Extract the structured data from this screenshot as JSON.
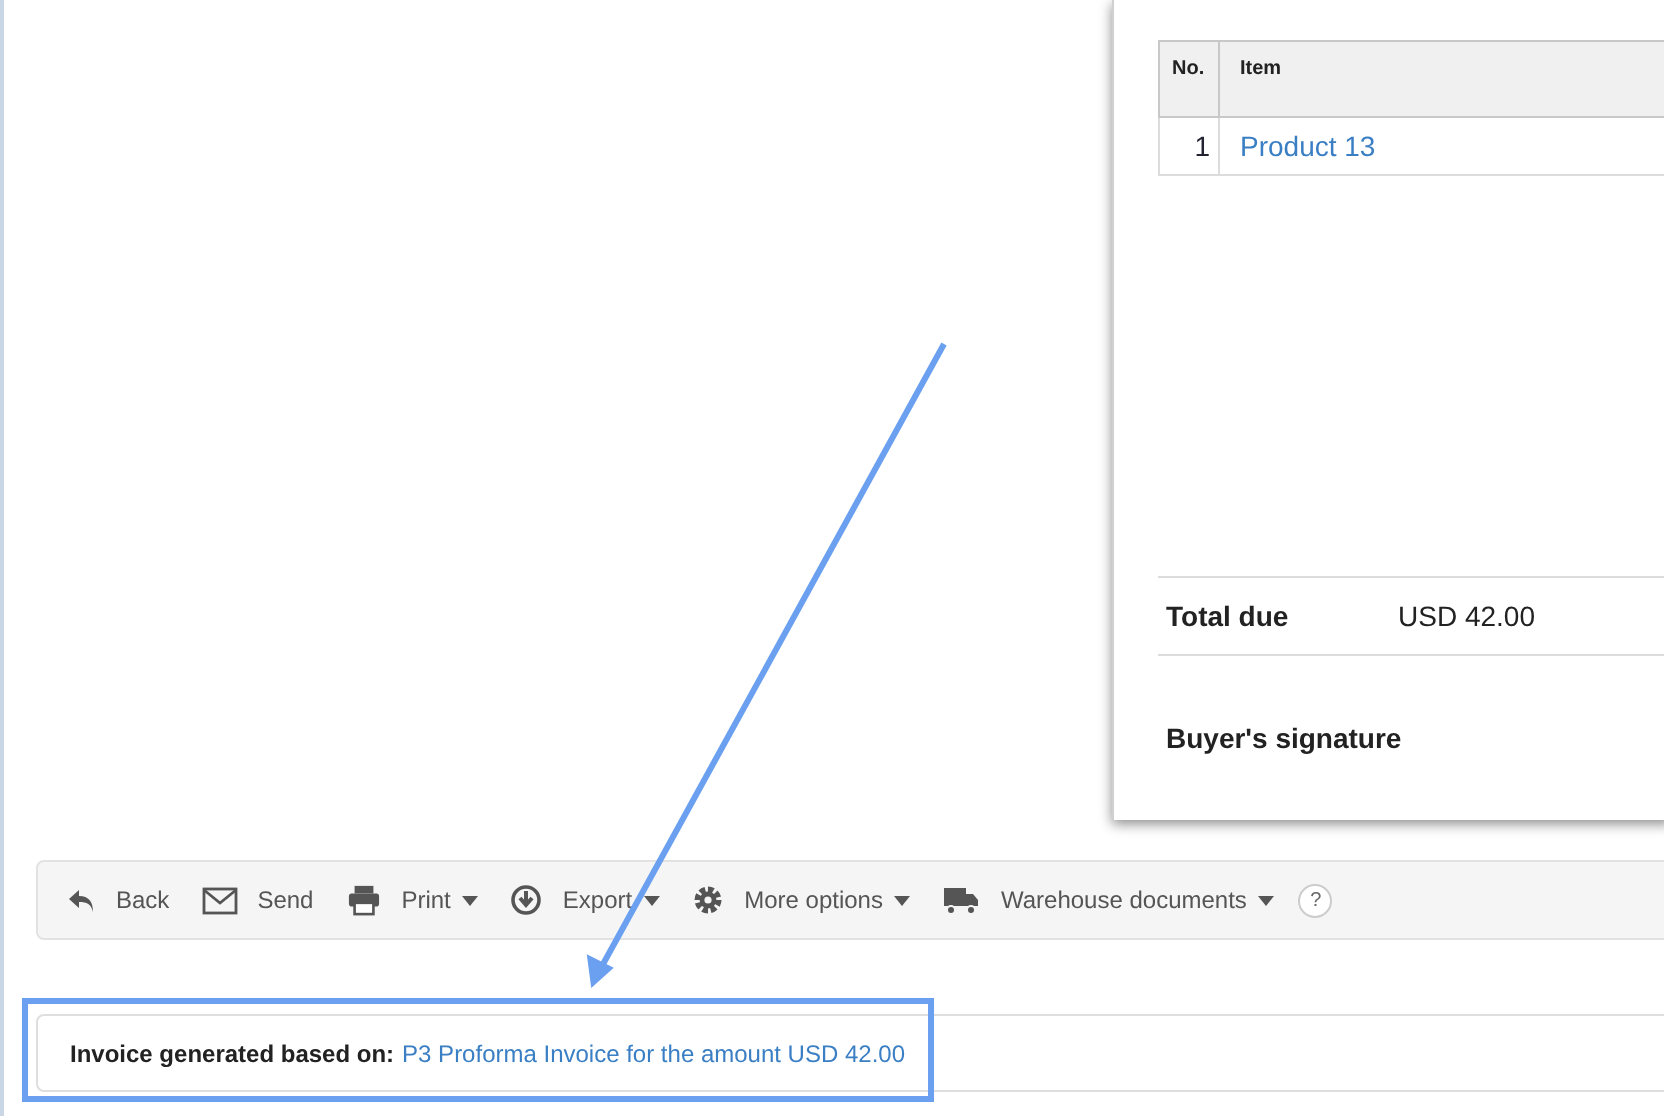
{
  "document": {
    "table": {
      "columns": [
        "No.",
        "Item"
      ],
      "rows": [
        {
          "no": "1",
          "item": "Product 13"
        }
      ]
    },
    "total": {
      "label": "Total due",
      "value": "USD 42.00"
    },
    "signature": "Buyer's signature"
  },
  "toolbar": [
    {
      "label": "Back",
      "caret": false
    },
    {
      "label": "Send",
      "caret": false
    },
    {
      "label": "Print",
      "caret": true
    },
    {
      "label": "Export",
      "caret": true
    },
    {
      "label": "More options",
      "caret": true
    },
    {
      "label": "Warehouse documents",
      "caret": true
    }
  ],
  "help": "?",
  "info": {
    "label": "Invoice generated based on:",
    "link": "P3 Proforma Invoice for the amount USD 42.00"
  }
}
